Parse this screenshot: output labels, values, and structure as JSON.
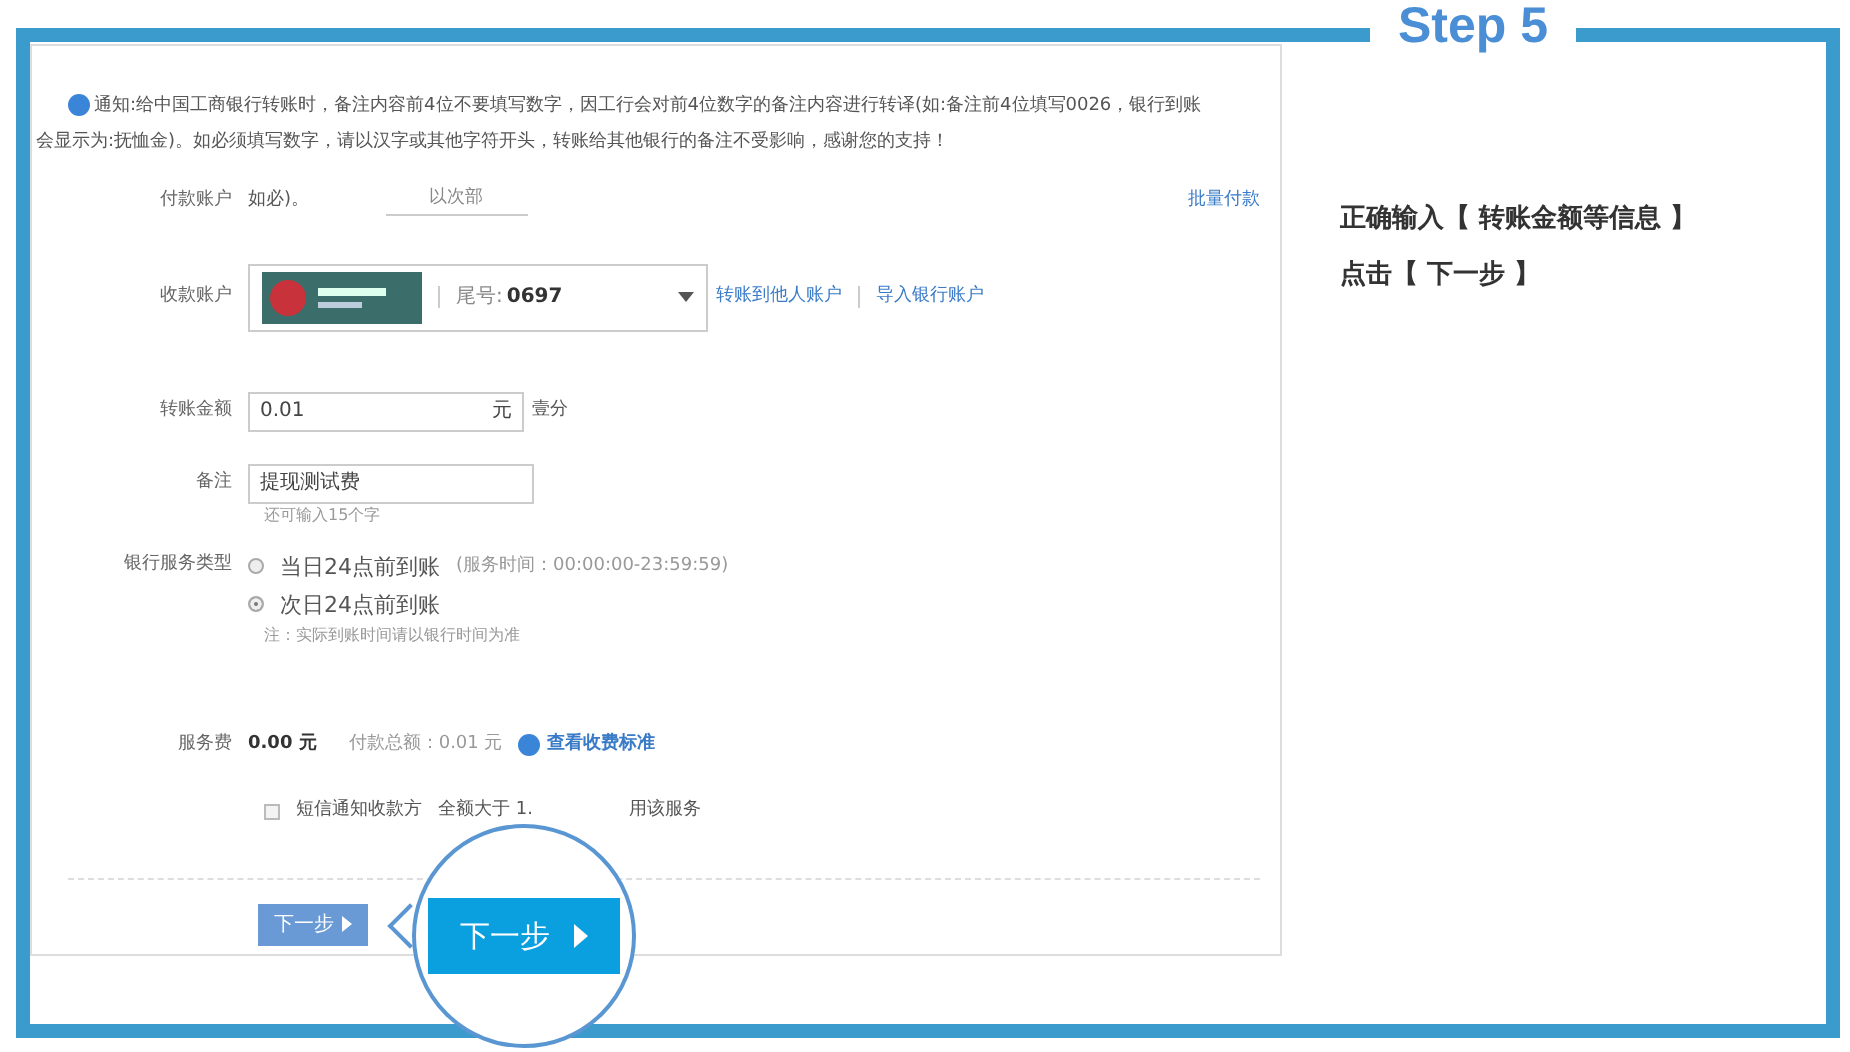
{
  "step_title": "Step 5",
  "notice": {
    "line1": "通知:给中国工商银行转账时，备注内容前4位不要填写数字，因工行会对前4位数字的备注内容进行转译(如:备注前4位填写0026，银行到账",
    "line2": "会显示为:抚恤金)。如必须填写数字，请以汉字或其他字符开头，转账给其他银行的备注不受影响，感谢您的支持！"
  },
  "payer": {
    "label": "付款账户",
    "value": "如必)。",
    "hint": "以次部",
    "link": "批量付款"
  },
  "payee": {
    "label": "收款账户",
    "tail_label": "尾号:",
    "tail": "0697",
    "links": [
      "转账到他人账户",
      "导入银行账户"
    ]
  },
  "amount": {
    "label": "转账金额",
    "value": "0.01",
    "unit": "元",
    "words": "壹分"
  },
  "remark": {
    "label": "备注",
    "value": "提现测试费",
    "hint": "还可输入15个字"
  },
  "service": {
    "label": "银行服务类型",
    "options": [
      {
        "text": "当日24点前到账",
        "note": "(服务时间：00:00:00-23:59:59)",
        "selected": false
      },
      {
        "text": "次日24点前到账",
        "selected": true
      }
    ],
    "note": "注：实际到账时间请以银行时间为准"
  },
  "fee": {
    "label": "服务费",
    "value": "0.00 元",
    "total_label": "付款总额：",
    "total": "0.01 元",
    "link": "查看收费标准"
  },
  "sms": {
    "label": "短信通知收款方",
    "checked": false,
    "texts": [
      "全额大于 1.",
      "用该服务"
    ]
  },
  "next_button": "下一步",
  "magnified_button": "下一步",
  "instructions": [
    "正确输入【 转账金额等信息 】",
    "点击【 下一步 】"
  ]
}
